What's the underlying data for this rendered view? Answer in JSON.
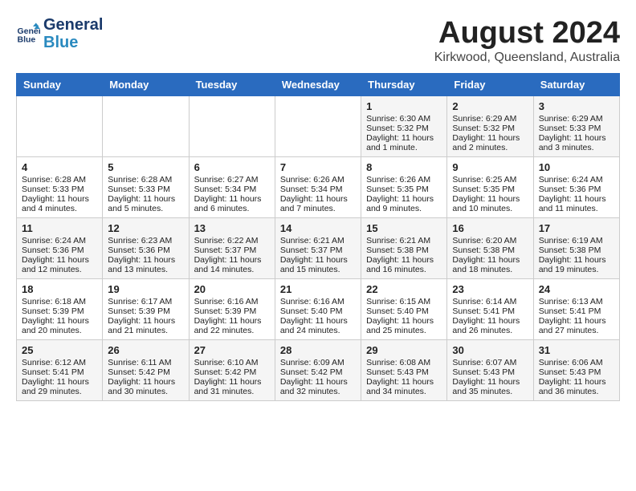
{
  "header": {
    "logo_line1": "General",
    "logo_line2": "Blue",
    "month_year": "August 2024",
    "location": "Kirkwood, Queensland, Australia"
  },
  "days_of_week": [
    "Sunday",
    "Monday",
    "Tuesday",
    "Wednesday",
    "Thursday",
    "Friday",
    "Saturday"
  ],
  "weeks": [
    [
      {
        "day": "",
        "details": ""
      },
      {
        "day": "",
        "details": ""
      },
      {
        "day": "",
        "details": ""
      },
      {
        "day": "",
        "details": ""
      },
      {
        "day": "1",
        "details": "Sunrise: 6:30 AM\nSunset: 5:32 PM\nDaylight: 11 hours and 1 minute."
      },
      {
        "day": "2",
        "details": "Sunrise: 6:29 AM\nSunset: 5:32 PM\nDaylight: 11 hours and 2 minutes."
      },
      {
        "day": "3",
        "details": "Sunrise: 6:29 AM\nSunset: 5:33 PM\nDaylight: 11 hours and 3 minutes."
      }
    ],
    [
      {
        "day": "4",
        "details": "Sunrise: 6:28 AM\nSunset: 5:33 PM\nDaylight: 11 hours and 4 minutes."
      },
      {
        "day": "5",
        "details": "Sunrise: 6:28 AM\nSunset: 5:33 PM\nDaylight: 11 hours and 5 minutes."
      },
      {
        "day": "6",
        "details": "Sunrise: 6:27 AM\nSunset: 5:34 PM\nDaylight: 11 hours and 6 minutes."
      },
      {
        "day": "7",
        "details": "Sunrise: 6:26 AM\nSunset: 5:34 PM\nDaylight: 11 hours and 7 minutes."
      },
      {
        "day": "8",
        "details": "Sunrise: 6:26 AM\nSunset: 5:35 PM\nDaylight: 11 hours and 9 minutes."
      },
      {
        "day": "9",
        "details": "Sunrise: 6:25 AM\nSunset: 5:35 PM\nDaylight: 11 hours and 10 minutes."
      },
      {
        "day": "10",
        "details": "Sunrise: 6:24 AM\nSunset: 5:36 PM\nDaylight: 11 hours and 11 minutes."
      }
    ],
    [
      {
        "day": "11",
        "details": "Sunrise: 6:24 AM\nSunset: 5:36 PM\nDaylight: 11 hours and 12 minutes."
      },
      {
        "day": "12",
        "details": "Sunrise: 6:23 AM\nSunset: 5:36 PM\nDaylight: 11 hours and 13 minutes."
      },
      {
        "day": "13",
        "details": "Sunrise: 6:22 AM\nSunset: 5:37 PM\nDaylight: 11 hours and 14 minutes."
      },
      {
        "day": "14",
        "details": "Sunrise: 6:21 AM\nSunset: 5:37 PM\nDaylight: 11 hours and 15 minutes."
      },
      {
        "day": "15",
        "details": "Sunrise: 6:21 AM\nSunset: 5:38 PM\nDaylight: 11 hours and 16 minutes."
      },
      {
        "day": "16",
        "details": "Sunrise: 6:20 AM\nSunset: 5:38 PM\nDaylight: 11 hours and 18 minutes."
      },
      {
        "day": "17",
        "details": "Sunrise: 6:19 AM\nSunset: 5:38 PM\nDaylight: 11 hours and 19 minutes."
      }
    ],
    [
      {
        "day": "18",
        "details": "Sunrise: 6:18 AM\nSunset: 5:39 PM\nDaylight: 11 hours and 20 minutes."
      },
      {
        "day": "19",
        "details": "Sunrise: 6:17 AM\nSunset: 5:39 PM\nDaylight: 11 hours and 21 minutes."
      },
      {
        "day": "20",
        "details": "Sunrise: 6:16 AM\nSunset: 5:39 PM\nDaylight: 11 hours and 22 minutes."
      },
      {
        "day": "21",
        "details": "Sunrise: 6:16 AM\nSunset: 5:40 PM\nDaylight: 11 hours and 24 minutes."
      },
      {
        "day": "22",
        "details": "Sunrise: 6:15 AM\nSunset: 5:40 PM\nDaylight: 11 hours and 25 minutes."
      },
      {
        "day": "23",
        "details": "Sunrise: 6:14 AM\nSunset: 5:41 PM\nDaylight: 11 hours and 26 minutes."
      },
      {
        "day": "24",
        "details": "Sunrise: 6:13 AM\nSunset: 5:41 PM\nDaylight: 11 hours and 27 minutes."
      }
    ],
    [
      {
        "day": "25",
        "details": "Sunrise: 6:12 AM\nSunset: 5:41 PM\nDaylight: 11 hours and 29 minutes."
      },
      {
        "day": "26",
        "details": "Sunrise: 6:11 AM\nSunset: 5:42 PM\nDaylight: 11 hours and 30 minutes."
      },
      {
        "day": "27",
        "details": "Sunrise: 6:10 AM\nSunset: 5:42 PM\nDaylight: 11 hours and 31 minutes."
      },
      {
        "day": "28",
        "details": "Sunrise: 6:09 AM\nSunset: 5:42 PM\nDaylight: 11 hours and 32 minutes."
      },
      {
        "day": "29",
        "details": "Sunrise: 6:08 AM\nSunset: 5:43 PM\nDaylight: 11 hours and 34 minutes."
      },
      {
        "day": "30",
        "details": "Sunrise: 6:07 AM\nSunset: 5:43 PM\nDaylight: 11 hours and 35 minutes."
      },
      {
        "day": "31",
        "details": "Sunrise: 6:06 AM\nSunset: 5:43 PM\nDaylight: 11 hours and 36 minutes."
      }
    ]
  ]
}
